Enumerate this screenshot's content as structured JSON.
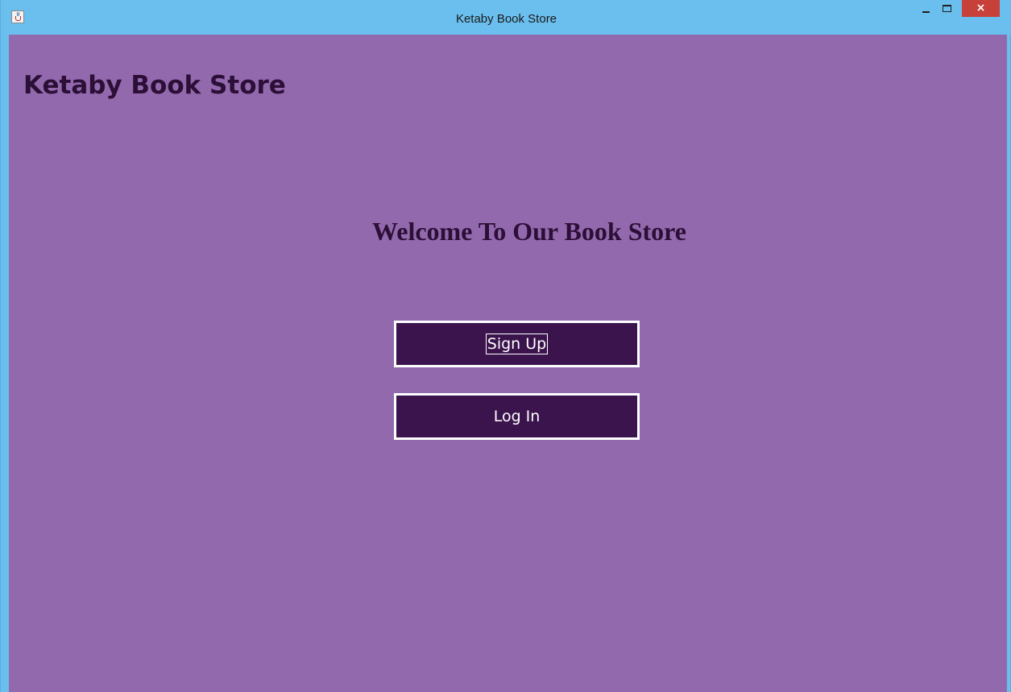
{
  "window": {
    "title": "Ketaby Book Store",
    "icon": "java-cup-icon",
    "controls": {
      "minimize": "minimize-icon",
      "maximize": "maximize-icon",
      "close_glyph": "×"
    }
  },
  "main": {
    "app_heading": "Ketaby Book Store",
    "welcome": "Welcome To Our Book Store",
    "signup_label": "Sign Up",
    "login_label": "Log In"
  },
  "colors": {
    "titlebar": "#6bbfee",
    "background": "#9369ae",
    "button": "#3b144d",
    "heading_text": "#2b0f36",
    "close_button": "#c7403a"
  }
}
